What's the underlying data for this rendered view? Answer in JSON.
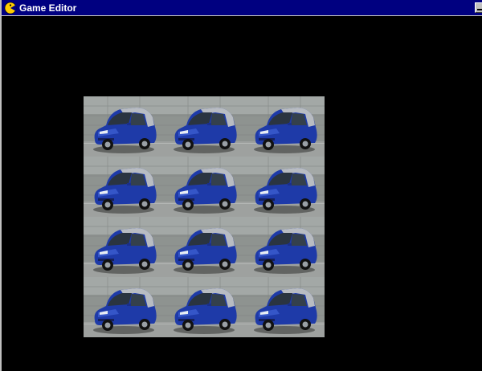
{
  "window": {
    "title": "Game Editor",
    "app_icon": "pacman-icon",
    "colors": {
      "titlebar": "#000080",
      "canvas": "#000000",
      "chrome": "#c0c0c0"
    }
  },
  "titlebar_buttons": {
    "minimize_icon": "minimize-icon"
  },
  "canvas": {
    "tile_image": "car-photo",
    "grid": {
      "columns": 3,
      "rows": 4
    }
  }
}
